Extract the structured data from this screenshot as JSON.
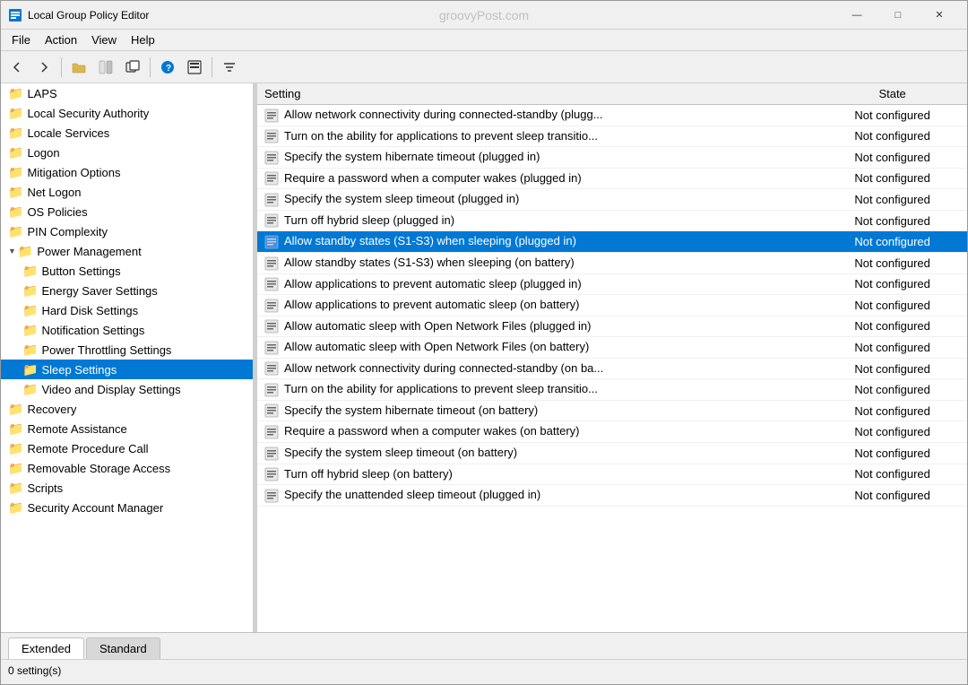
{
  "titleBar": {
    "title": "Local Group Policy Editor",
    "watermark": "groovyPost.com",
    "controls": {
      "minimize": "—",
      "maximize": "□",
      "close": "✕"
    }
  },
  "menuBar": {
    "items": [
      "File",
      "Action",
      "View",
      "Help"
    ]
  },
  "toolbar": {
    "buttons": [
      {
        "name": "back",
        "icon": "◀",
        "disabled": false
      },
      {
        "name": "forward",
        "icon": "▶",
        "disabled": false
      },
      {
        "name": "up",
        "icon": "📁",
        "disabled": false
      },
      {
        "name": "show-hide",
        "icon": "☰",
        "disabled": false
      },
      {
        "name": "new-window",
        "icon": "🗗",
        "disabled": false
      },
      {
        "name": "help",
        "icon": "?",
        "disabled": false
      },
      {
        "name": "export",
        "icon": "⊞",
        "disabled": false
      },
      {
        "name": "filter",
        "icon": "▽",
        "disabled": false
      }
    ]
  },
  "leftPanel": {
    "items": [
      {
        "label": "LAPS",
        "level": 0,
        "type": "folder",
        "expanded": false
      },
      {
        "label": "Local Security Authority",
        "level": 0,
        "type": "folder",
        "expanded": false
      },
      {
        "label": "Locale Services",
        "level": 0,
        "type": "folder",
        "expanded": false
      },
      {
        "label": "Logon",
        "level": 0,
        "type": "folder",
        "expanded": false
      },
      {
        "label": "Mitigation Options",
        "level": 0,
        "type": "folder",
        "expanded": false
      },
      {
        "label": "Net Logon",
        "level": 0,
        "type": "folder",
        "expanded": false
      },
      {
        "label": "OS Policies",
        "level": 0,
        "type": "folder",
        "expanded": false
      },
      {
        "label": "PIN Complexity",
        "level": 0,
        "type": "folder",
        "expanded": false
      },
      {
        "label": "Power Management",
        "level": 0,
        "type": "folder",
        "expanded": true
      },
      {
        "label": "Button Settings",
        "level": 1,
        "type": "folder",
        "expanded": false
      },
      {
        "label": "Energy Saver Settings",
        "level": 1,
        "type": "folder",
        "expanded": false
      },
      {
        "label": "Hard Disk Settings",
        "level": 1,
        "type": "folder",
        "expanded": false
      },
      {
        "label": "Notification Settings",
        "level": 1,
        "type": "folder",
        "expanded": false
      },
      {
        "label": "Power Throttling Settings",
        "level": 1,
        "type": "folder",
        "expanded": false
      },
      {
        "label": "Sleep Settings",
        "level": 1,
        "type": "folder",
        "selected": true
      },
      {
        "label": "Video and Display Settings",
        "level": 1,
        "type": "folder",
        "expanded": false
      },
      {
        "label": "Recovery",
        "level": 0,
        "type": "folder",
        "expanded": false
      },
      {
        "label": "Remote Assistance",
        "level": 0,
        "type": "folder",
        "expanded": false
      },
      {
        "label": "Remote Procedure Call",
        "level": 0,
        "type": "folder",
        "expanded": false
      },
      {
        "label": "Removable Storage Access",
        "level": 0,
        "type": "folder",
        "expanded": false
      },
      {
        "label": "Scripts",
        "level": 0,
        "type": "folder",
        "expanded": false
      },
      {
        "label": "Security Account Manager",
        "level": 0,
        "type": "folder",
        "expanded": false
      }
    ]
  },
  "tableHeader": {
    "setting": "Setting",
    "state": "State"
  },
  "tableRows": [
    {
      "setting": "Allow network connectivity during connected-standby (plugg...",
      "state": "Not configured",
      "highlighted": false
    },
    {
      "setting": "Turn on the ability for applications to prevent sleep transitio...",
      "state": "Not configured",
      "highlighted": false
    },
    {
      "setting": "Specify the system hibernate timeout (plugged in)",
      "state": "Not configured",
      "highlighted": false
    },
    {
      "setting": "Require a password when a computer wakes (plugged in)",
      "state": "Not configured",
      "highlighted": false
    },
    {
      "setting": "Specify the system sleep timeout (plugged in)",
      "state": "Not configured",
      "highlighted": false
    },
    {
      "setting": "Turn off hybrid sleep (plugged in)",
      "state": "Not configured",
      "highlighted": false
    },
    {
      "setting": "Allow standby states (S1-S3) when sleeping (plugged in)",
      "state": "Not configured",
      "highlighted": true
    },
    {
      "setting": "Allow standby states (S1-S3) when sleeping (on battery)",
      "state": "Not configured",
      "highlighted": false
    },
    {
      "setting": "Allow applications to prevent automatic sleep (plugged in)",
      "state": "Not configured",
      "highlighted": false
    },
    {
      "setting": "Allow applications to prevent automatic sleep (on battery)",
      "state": "Not configured",
      "highlighted": false
    },
    {
      "setting": "Allow automatic sleep with Open Network Files (plugged in)",
      "state": "Not configured",
      "highlighted": false
    },
    {
      "setting": "Allow automatic sleep with Open Network Files (on battery)",
      "state": "Not configured",
      "highlighted": false
    },
    {
      "setting": "Allow network connectivity during connected-standby (on ba...",
      "state": "Not configured",
      "highlighted": false
    },
    {
      "setting": "Turn on the ability for applications to prevent sleep transitio...",
      "state": "Not configured",
      "highlighted": false
    },
    {
      "setting": "Specify the system hibernate timeout (on battery)",
      "state": "Not configured",
      "highlighted": false
    },
    {
      "setting": "Require a password when a computer wakes (on battery)",
      "state": "Not configured",
      "highlighted": false
    },
    {
      "setting": "Specify the system sleep timeout (on battery)",
      "state": "Not configured",
      "highlighted": false
    },
    {
      "setting": "Turn off hybrid sleep (on battery)",
      "state": "Not configured",
      "highlighted": false
    },
    {
      "setting": "Specify the unattended sleep timeout (plugged in)",
      "state": "Not configured",
      "highlighted": false
    }
  ],
  "tabs": [
    {
      "label": "Extended",
      "active": true
    },
    {
      "label": "Standard",
      "active": false
    }
  ],
  "statusBar": {
    "text": "0 setting(s)"
  }
}
